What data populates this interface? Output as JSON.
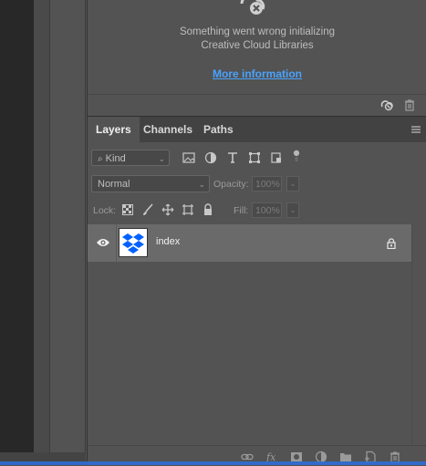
{
  "libraries": {
    "error_line1": "Something went wrong initializing",
    "error_line2": "Creative Cloud Libraries",
    "more_info_link": "More information",
    "footer_icons": [
      "cloud-sync-icon",
      "trash-icon"
    ]
  },
  "tabs": [
    {
      "label": "Layers",
      "active": true
    },
    {
      "label": "Channels",
      "active": false
    },
    {
      "label": "Paths",
      "active": false
    }
  ],
  "filter": {
    "kind_label": "Kind",
    "filter_icons": [
      "pixel-filter-icon",
      "adjustment-filter-icon",
      "type-filter-icon",
      "shape-filter-icon",
      "smartobject-filter-icon",
      "filter-toggle-icon"
    ]
  },
  "blend": {
    "mode": "Normal",
    "opacity_label": "Opacity:",
    "opacity_value": "100%",
    "fill_label": "Fill:",
    "fill_value": "100%"
  },
  "lock": {
    "label": "Lock:",
    "icons": [
      "lock-transparent-icon",
      "lock-image-icon",
      "lock-position-icon",
      "lock-artboard-icon",
      "lock-all-icon"
    ]
  },
  "layers": [
    {
      "name": "index",
      "visible": true,
      "locked": true
    }
  ],
  "bottom_toolbar": [
    "link-layers-icon",
    "fx-icon",
    "add-mask-icon",
    "adjustment-layer-icon",
    "new-group-icon",
    "new-layer-icon",
    "delete-layer-icon"
  ],
  "colors": {
    "link": "#4aa3ff",
    "panel_bg": "#535353",
    "tab_bar": "#424242",
    "selected_row": "#6a6a6a",
    "dropbox_blue": "#0061fe"
  }
}
